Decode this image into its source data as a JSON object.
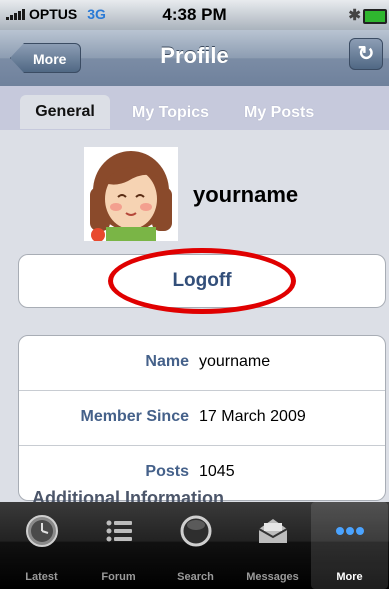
{
  "status_bar": {
    "carrier": "OPTUS",
    "network": "3G",
    "time": "4:38 PM",
    "bluetooth_icon": "bluetooth-icon",
    "battery_icon": "battery-icon"
  },
  "nav": {
    "back_label": "More",
    "title": "Profile",
    "refresh_icon": "refresh-icon"
  },
  "tabs": [
    {
      "label": "General",
      "active": true
    },
    {
      "label": "My Topics",
      "active": false
    },
    {
      "label": "My Posts",
      "active": false
    }
  ],
  "profile": {
    "username": "yourname",
    "logoff_label": "Logoff"
  },
  "details": [
    {
      "key": "Name",
      "value": "yourname"
    },
    {
      "key": "Member Since",
      "value": "17 March 2009"
    },
    {
      "key": "Posts",
      "value": "1045"
    }
  ],
  "section_header": "Additional Information",
  "tabbar": [
    {
      "label": "Latest",
      "icon": "clock-icon"
    },
    {
      "label": "Forum",
      "icon": "list-icon"
    },
    {
      "label": "Search",
      "icon": "search-icon"
    },
    {
      "label": "Messages",
      "icon": "envelope-icon"
    },
    {
      "label": "More",
      "icon": "more-icon",
      "active": true
    }
  ],
  "colors": {
    "annotation_circle": "#e00000",
    "label_blue": "#45618a"
  }
}
